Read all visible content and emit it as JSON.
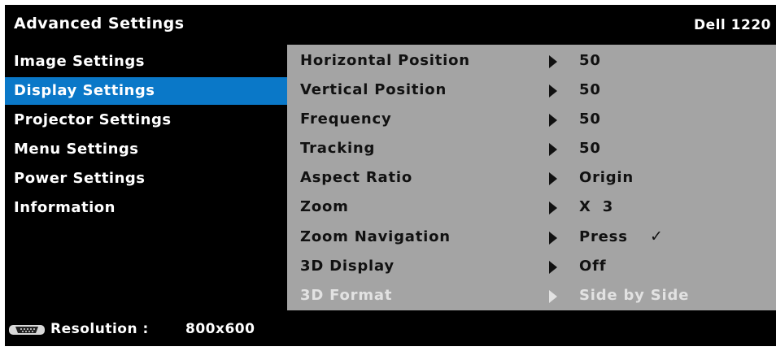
{
  "header": {
    "title": "Advanced Settings",
    "model": "Dell 1220"
  },
  "sidebar": {
    "items": [
      {
        "label": "Image Settings"
      },
      {
        "label": "Display Settings"
      },
      {
        "label": "Projector Settings"
      },
      {
        "label": "Menu Settings"
      },
      {
        "label": "Power Settings"
      },
      {
        "label": "Information"
      }
    ],
    "active_index": 1
  },
  "settings": [
    {
      "label": "Horizontal Position",
      "value": "50"
    },
    {
      "label": "Vertical Position",
      "value": "50"
    },
    {
      "label": "Frequency",
      "value": "50"
    },
    {
      "label": "Tracking",
      "value": "50"
    },
    {
      "label": "Aspect Ratio",
      "value": "Origin"
    },
    {
      "label": "Zoom",
      "value": "X  3"
    },
    {
      "label": "Zoom Navigation",
      "value": "Press",
      "check": "✓"
    },
    {
      "label": "3D Display",
      "value": "Off"
    },
    {
      "label": "3D Format",
      "value": "Side by Side",
      "disabled": true
    }
  ],
  "footer": {
    "resolution_label": "Resolution :",
    "resolution_value": "800x600",
    "icon": "vga-connector-icon"
  },
  "colors": {
    "accent": "#0a78c8",
    "panel": "#a4a4a4",
    "background": "#000000",
    "disabled_text": "#e2e2e2"
  }
}
